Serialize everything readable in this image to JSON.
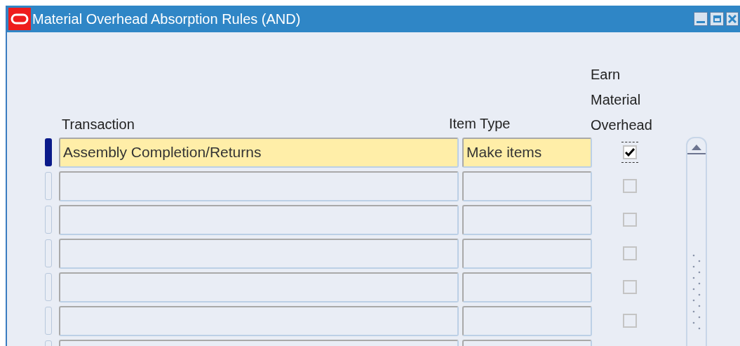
{
  "window": {
    "title": "Material Overhead Absorption Rules (AND)"
  },
  "columns": {
    "transaction": "Transaction",
    "item_type": "Item Type",
    "earn": [
      "Earn",
      "Material",
      "Overhead"
    ]
  },
  "rows": [
    {
      "current": true,
      "transaction": "Assembly Completion/Returns",
      "item_type": "Make items",
      "earn": true
    },
    {
      "current": false,
      "earn": false
    },
    {
      "current": false,
      "earn": false
    },
    {
      "current": false,
      "earn": false
    },
    {
      "current": false,
      "earn": false
    },
    {
      "current": false,
      "earn": false
    },
    {
      "current": false
    }
  ]
}
